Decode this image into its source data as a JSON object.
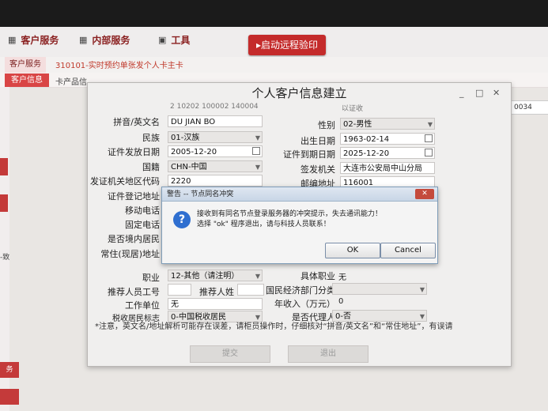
{
  "topnav": {
    "items": [
      {
        "label": "客户服务",
        "icon": "grid-icon"
      },
      {
        "label": "内部服务",
        "icon": "grid-icon"
      },
      {
        "label": "工具",
        "icon": "tool-icon"
      }
    ],
    "remote_button": "▸启动远程验印"
  },
  "subnav": {
    "tab": "客户服务",
    "text": "310101-实时预约单张发个人卡主卡",
    "tab2": "客户信息",
    "tab3": "卡产品信"
  },
  "left": {
    "text1": "-致",
    "text2": "务"
  },
  "right_field": "0034",
  "dialog": {
    "title": "个人客户信息建立",
    "controls": {
      "min": "_",
      "max": "□",
      "close": "✕"
    },
    "top_partial_left": "2 10202 100002 140004",
    "top_partial_right": "以证收",
    "fields": {
      "pinyin_label": "拼音/英文名",
      "pinyin_value": "DU JIAN BO",
      "gender_label": "性别",
      "gender_value": "02-男性",
      "ethnic_label": "民族",
      "ethnic_value": "01-汉族",
      "birth_label": "出生日期",
      "birth_value": "1963-02-14",
      "issue_label": "证件发放日期",
      "issue_value": "2005-12-20",
      "expire_label": "证件到期日期",
      "expire_value": "2025-12-20",
      "country_label": "国籍",
      "country_value": "CHN-中国",
      "authority_label": "签发机关",
      "authority_value": "大连市公安局中山分局",
      "region_label": "发证机关地区代码",
      "region_value": "2220",
      "postcode_label": "邮编地址",
      "postcode_value": "116001",
      "regaddr_label": "证件登记地址",
      "mobile_label": "移动电话",
      "phone_label": "固定电话",
      "resident_label": "是否境内居民",
      "homeaddr_label": "常住(现居)地址",
      "job_label": "职业",
      "job_value": "12-其他（请注明）",
      "jobdetail_label": "具体职业",
      "jobdetail_value": "无",
      "referrer_id_label": "推荐人员工号",
      "referrer_name_label": "推荐人姓",
      "industry_label": "国民经济部门分类",
      "employer_label": "工作单位",
      "employer_value": "无",
      "income_label": "年收入（万元）",
      "income_value": "0",
      "tax_label": "税收居民标志",
      "tax_value": "0-中国税收居民",
      "agent_label": "是否代理人",
      "agent_value": "0-否"
    },
    "notice": "*注意，英文名/地址解析可能存在误差，请柜员操作时，仔细核对“拼音/英文名”和“常住地址”，有误请",
    "submit": "提交",
    "exit": "退出"
  },
  "warning": {
    "title": "警告 -- 节点同名冲突",
    "line1": "接收到有同名节点登录服务器的冲突提示，失去通讯能力！",
    "line2": "选择 \"ok\" 程序退出，请与科技人员联系！",
    "ok": "OK",
    "cancel": "Cancel",
    "close": "✕"
  }
}
